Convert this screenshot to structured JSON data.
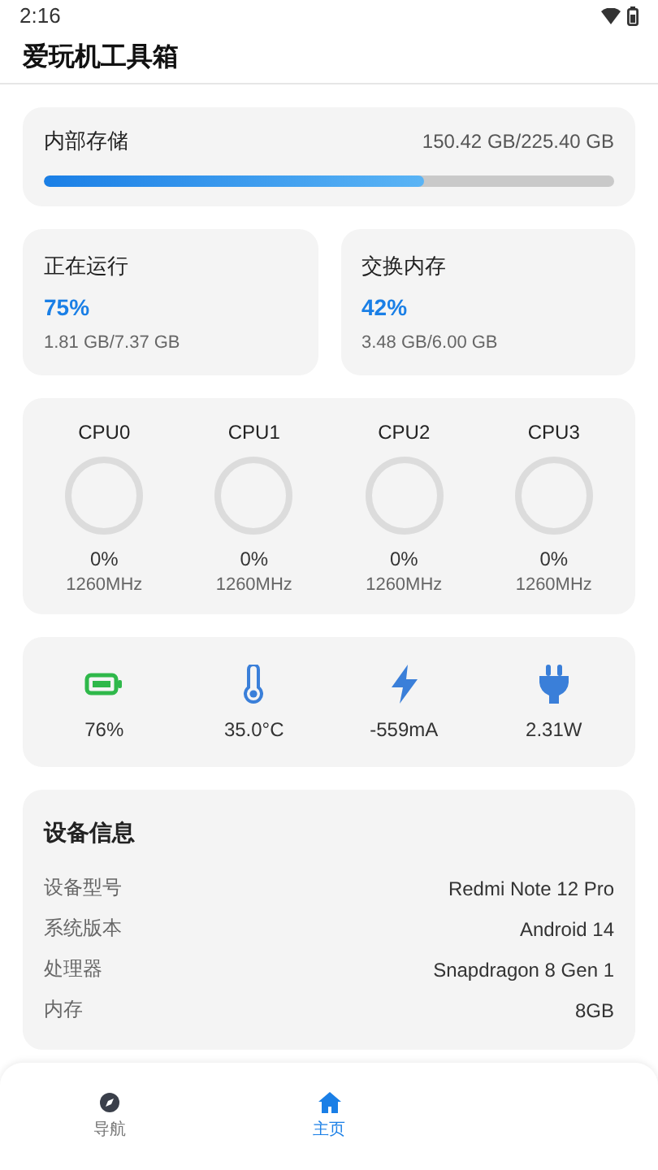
{
  "status_bar": {
    "time": "2:16"
  },
  "app_bar": {
    "title": "爱玩机工具箱"
  },
  "storage": {
    "label": "内部存储",
    "reading": "150.42 GB/225.40 GB",
    "level": 0.667
  },
  "memory": [
    {
      "label": "正在运行",
      "percent": "75%",
      "detail": "1.81 GB/7.37 GB"
    },
    {
      "label": "交换内存",
      "percent": "42%",
      "detail": "3.48 GB/6.00 GB"
    }
  ],
  "cpus": [
    {
      "name": "CPU0",
      "usage": "0%",
      "freq": "1260MHz"
    },
    {
      "name": "CPU1",
      "usage": "0%",
      "freq": "1260MHz"
    },
    {
      "name": "CPU2",
      "usage": "0%",
      "freq": "1260MHz"
    },
    {
      "name": "CPU3",
      "usage": "0%",
      "freq": "1260MHz"
    }
  ],
  "stats": [
    {
      "kind": "battery",
      "value": "76%",
      "color": "#2fb84a"
    },
    {
      "kind": "temperature",
      "value": "35.0°C",
      "color": "#3a7fd9"
    },
    {
      "kind": "current",
      "value": "-559mA",
      "color": "#3a7fd9"
    },
    {
      "kind": "power",
      "value": "2.31W",
      "color": "#3a7fd9"
    }
  ],
  "device_info": {
    "title": "设备信息",
    "rows": [
      {
        "label": "设备型号",
        "value": "Redmi Note 12 Pro"
      },
      {
        "label": "系统版本",
        "value": "Android 14"
      },
      {
        "label": "处理器",
        "value": "Snapdragon 8 Gen 1"
      },
      {
        "label": "内存",
        "value": "8GB"
      }
    ]
  },
  "nav": [
    {
      "kind": "compass",
      "label": "导航",
      "selected": false
    },
    {
      "kind": "home",
      "label": "主页",
      "selected": true
    }
  ]
}
